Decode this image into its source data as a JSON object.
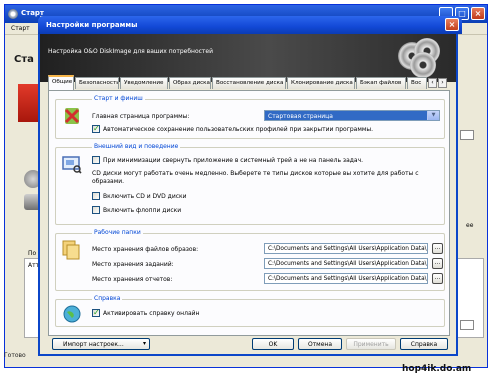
{
  "background_app": {
    "title": "Старт",
    "menu": "Старт",
    "heading": "Ста",
    "po_label": "По",
    "att_label": "Атт",
    "right_label": "ее",
    "status": "Готово"
  },
  "dialog": {
    "title": "Настройки программы",
    "subtitle": "Настройка O&O DiskImage для ваших потребностей",
    "tabs": [
      "Общие",
      "Безопасность",
      "Уведомление",
      "Образ диска",
      "Восстановление диска",
      "Клонирование диска",
      "Бэкап файлов",
      "Вос"
    ],
    "active_tab": "Общие",
    "groups": {
      "startup": {
        "title": "Старт и финиш",
        "home_label": "Главная страница программы:",
        "home_value": "Стартовая страница",
        "autosave_label": "Автоматическое сохранение пользовательских профилей при закрытии программы.",
        "autosave_checked": true
      },
      "appearance": {
        "title": "Внешний вид и поведение",
        "tray_label": "При минимизации свернуть приложение в системный трей а не на панель задач.",
        "tray_checked": false,
        "info_text": "CD диски могут работать очень медленно. Выберете те типы дисков которые вы хотите для работы с образами.",
        "cd_label": "Включить CD и DVD диски",
        "cd_checked": false,
        "floppy_label": "Включить флоппи диски",
        "floppy_checked": false
      },
      "folders": {
        "title": "Рабочие папки",
        "images_label": "Место хранения файлов образов:",
        "images_path": "C:\\Documents and Settings\\All Users\\Application Data\\",
        "tasks_label": "Место хранения заданий:",
        "tasks_path": "C:\\Documents and Settings\\All Users\\Application Data\\",
        "reports_label": "Место хранения отчетов:",
        "reports_path": "C:\\Documents and Settings\\All Users\\Application Data\\",
        "browse": "..."
      },
      "help": {
        "title": "Справка",
        "online_label": "Активировать справку онлайн",
        "online_checked": true
      }
    },
    "buttons": {
      "import": "Импорт настроек...",
      "ok": "OK",
      "cancel": "Отмена",
      "apply": "Применить",
      "help": "Справка"
    }
  },
  "watermark": "hop4ik.do.am"
}
